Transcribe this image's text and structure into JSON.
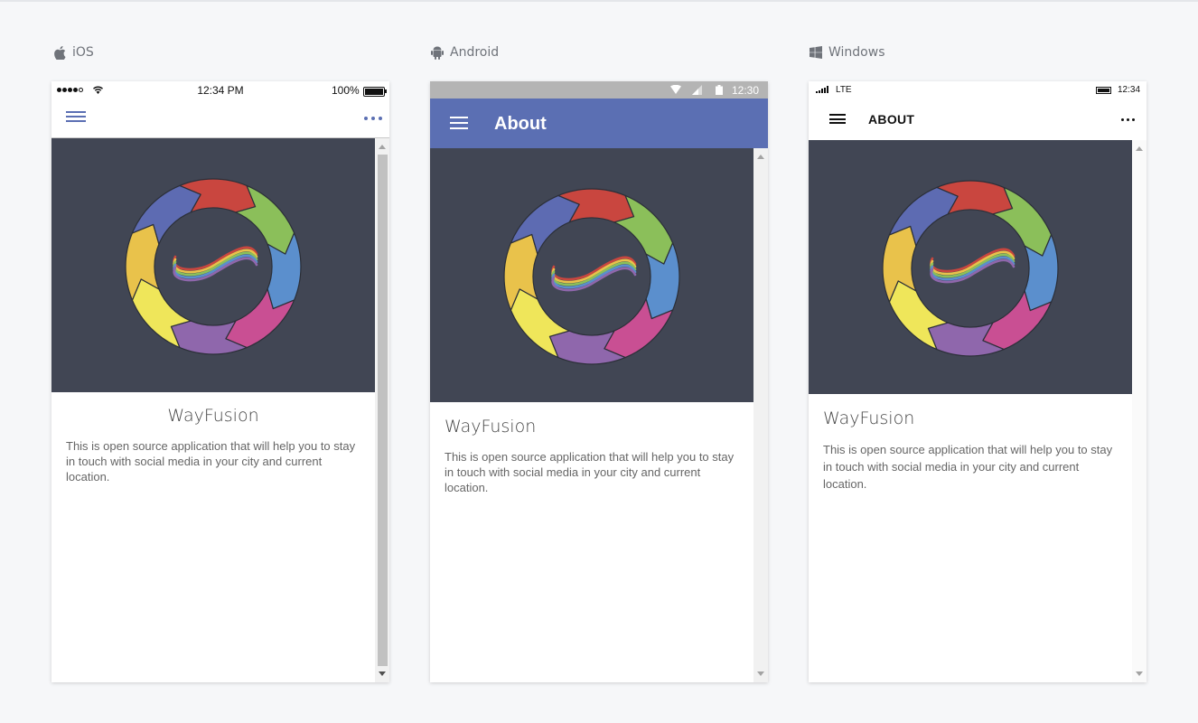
{
  "platforms": [
    {
      "id": "ios",
      "label": "iOS",
      "icon": "apple-icon",
      "status": {
        "time": "12:34 PM",
        "battery": "100%"
      },
      "nav": {
        "title": ""
      },
      "app_name": "WayFusion",
      "description": "This is open source application that will help you to stay in touch with social media in your city and current location."
    },
    {
      "id": "android",
      "label": "Android",
      "icon": "android-icon",
      "status": {
        "time": "12:30"
      },
      "nav": {
        "title": "About"
      },
      "app_name": "WayFusion",
      "description": "This is open source application that will help you to stay in touch with social media in your city and current location."
    },
    {
      "id": "windows",
      "label": "Windows",
      "icon": "windows-icon",
      "status": {
        "time": "12:34",
        "network": "LTE"
      },
      "nav": {
        "title": "ABOUT"
      },
      "app_name": "WayFusion",
      "description": "This is open source application that will help you to stay in touch with social media in your city and current location."
    }
  ],
  "colors": {
    "accent": "#5b6fb3",
    "hero_background": "#414654",
    "ring_segments": [
      "#c9463f",
      "#8bbf5a",
      "#5b8fcd",
      "#c94f93",
      "#8f67ac",
      "#efe65a",
      "#e9c24b",
      "#5d6bb2"
    ]
  }
}
